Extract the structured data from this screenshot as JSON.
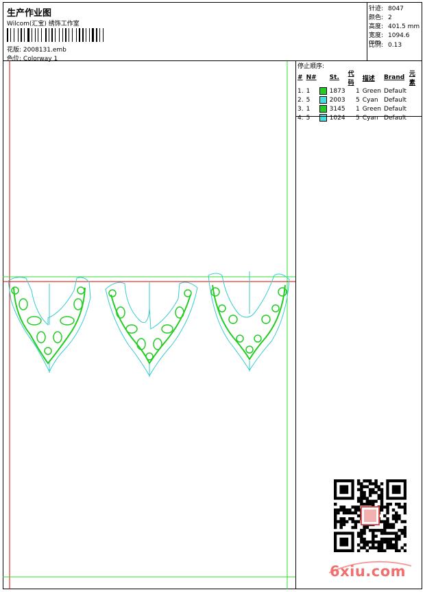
{
  "header": {
    "title": "生产作业图",
    "company": "Wilcom(汇宝) 绣饰工作室",
    "file_label": "花版:",
    "file_name": "2008131.emb",
    "colorway_label": "色位:",
    "colorway_name": "Colorway 1"
  },
  "specs": [
    {
      "label": "针迹:",
      "value": "8047"
    },
    {
      "label": "颜色:",
      "value": "2"
    },
    {
      "label": "高度:",
      "value": "401.5 mm"
    },
    {
      "label": "宽度:",
      "value": "1094.6 mm"
    },
    {
      "label": "比例:",
      "value": "0.13"
    }
  ],
  "stop_sequence": {
    "heading": "停止顺序:",
    "columns": [
      "#",
      "N#",
      "St.",
      "代码",
      "描述",
      "Brand",
      "元素"
    ],
    "rows": [
      {
        "num": "1.",
        "needle": "1",
        "color": "#22cc22",
        "stitches": "1873",
        "code": "1",
        "desc": "Green",
        "brand": "Default"
      },
      {
        "num": "2.",
        "needle": "5",
        "color": "#44dddd",
        "stitches": "2003",
        "code": "5",
        "desc": "Cyan",
        "brand": "Default"
      },
      {
        "num": "3.",
        "needle": "1",
        "color": "#22cc22",
        "stitches": "3145",
        "code": "1",
        "desc": "Green",
        "brand": "Default"
      },
      {
        "num": "4.",
        "needle": "5",
        "color": "#44dddd",
        "stitches": "1024",
        "code": "5",
        "desc": "Cyan",
        "brand": "Default"
      }
    ]
  },
  "watermark": {
    "text": "6xiu.com"
  },
  "colors": {
    "green": "#22cc22",
    "cyan": "#33cccc",
    "red": "#dd0000",
    "guide_green": "#33dd33"
  }
}
